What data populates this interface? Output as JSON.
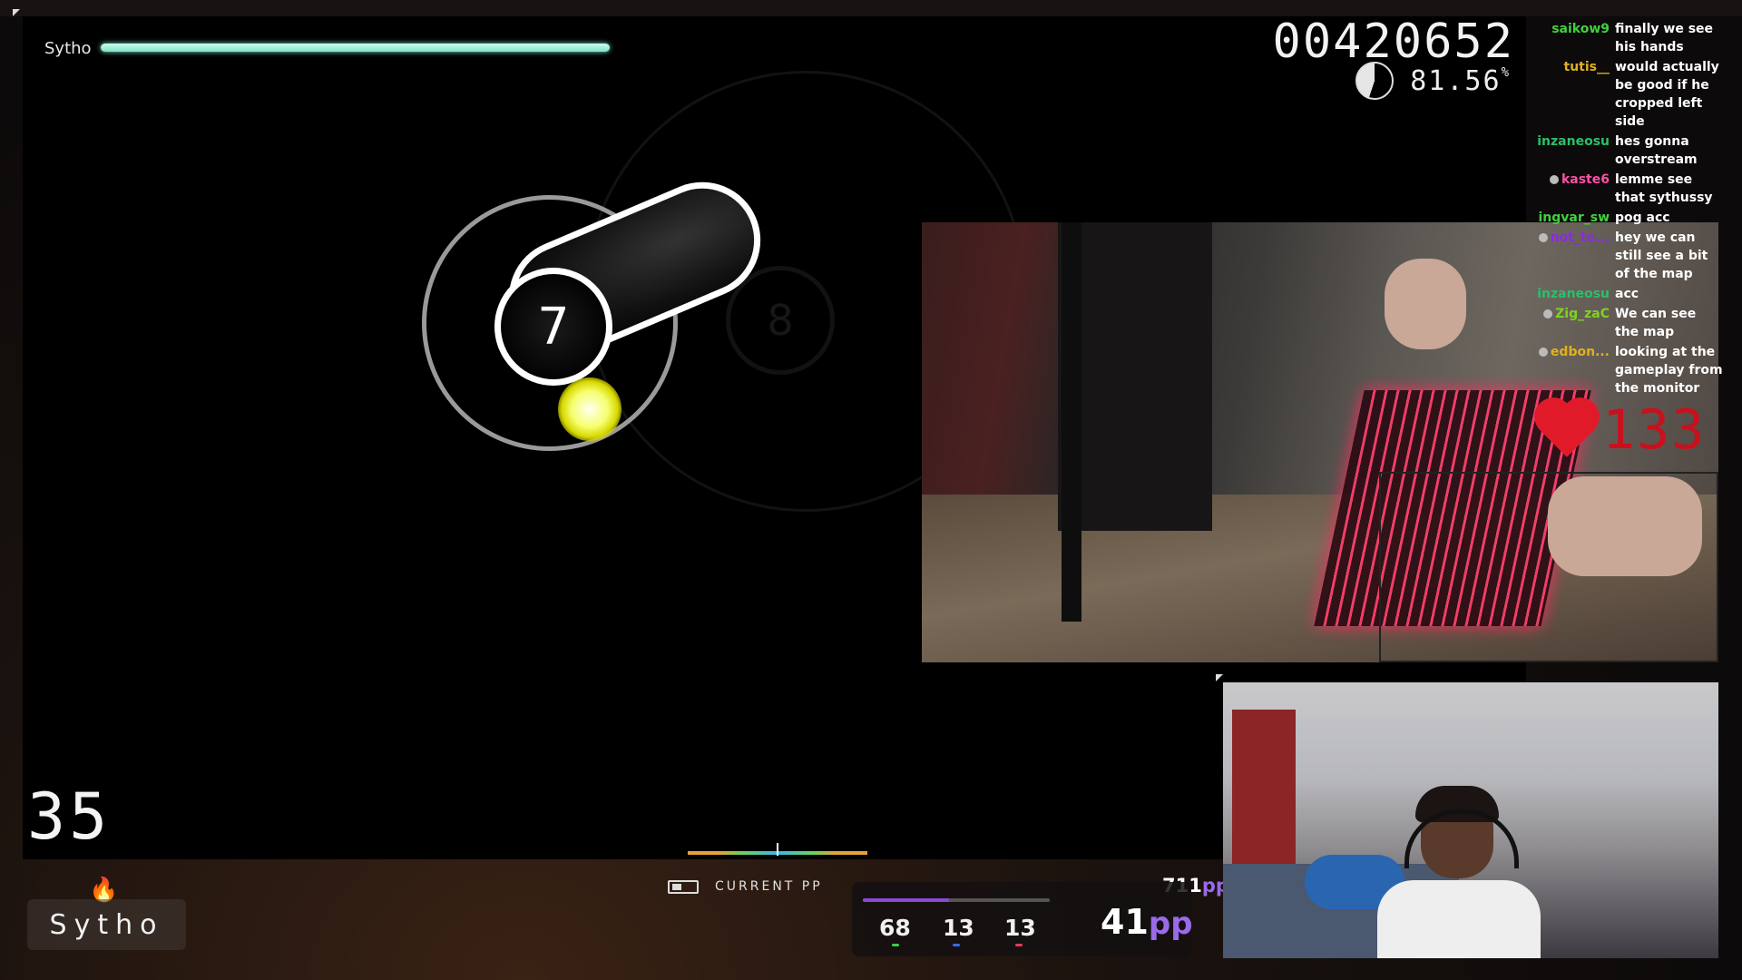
{
  "game": {
    "player_name": "Sytho",
    "health": 1.0,
    "score": "00420652",
    "accuracy": "81.56",
    "accuracy_unit": "%",
    "combo": "35",
    "hit_circle_number": "7",
    "next_circle_number": "8"
  },
  "hud": {
    "profile_name": "Sytho",
    "current_pp_label": "CURRENT PP",
    "max_pp": "711",
    "pp_unit": "pp",
    "current_pp": "41",
    "count_300": "68",
    "count_100": "13",
    "count_miss": "13",
    "progress": 0.46,
    "colors": {
      "accent": "#9a6ae8",
      "health": "#7fe3c5",
      "heart": "#e11a2a"
    }
  },
  "chat": [
    {
      "user": "saikow9",
      "color": "#3fd13f",
      "message": "finally we see his hands",
      "badge": false
    },
    {
      "user": "tutis__",
      "color": "#e0b020",
      "message": "would actually be good if he cropped left side",
      "badge": false
    },
    {
      "user": "inzaneosu",
      "color": "#2bbf6b",
      "message": "hes gonna overstream",
      "badge": false
    },
    {
      "user": "kaste6",
      "color": "#ff4fa8",
      "message": "lemme see that sythussy",
      "badge": true
    },
    {
      "user": "ingvar_sw",
      "color": "#3fd13f",
      "message": "pog acc",
      "badge": false
    },
    {
      "user": "not_te...",
      "color": "#8a2be2",
      "message": "hey we can still see a bit of the map",
      "badge": true
    },
    {
      "user": "inzaneosu",
      "color": "#2bbf6b",
      "message": "acc",
      "badge": false
    },
    {
      "user": "Zig_zaC",
      "color": "#7ed321",
      "message": "We can see the map",
      "badge": true
    },
    {
      "user": "edbon...",
      "color": "#e0b020",
      "message": "looking at the gameplay from the monitor",
      "badge": true
    }
  ],
  "heart_rate": "133",
  "icons": {
    "heart": "heart-icon",
    "flame": "flame-icon",
    "battery": "battery-icon",
    "accuracy_pie": "accuracy-pie-icon"
  }
}
